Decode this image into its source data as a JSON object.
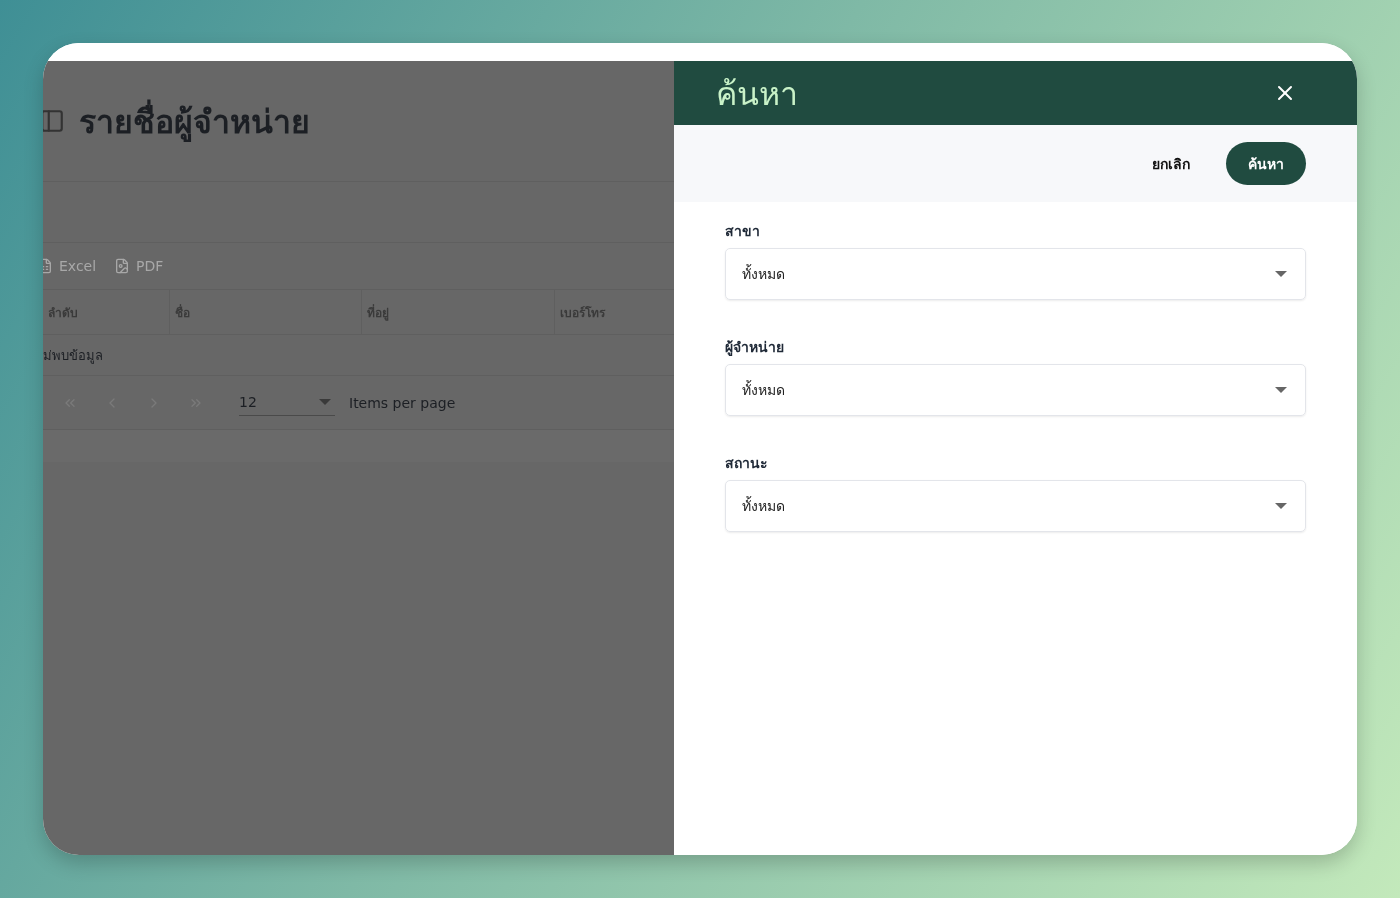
{
  "page": {
    "title": "รายชื่อผู้จำหน่าย",
    "exports": [
      "Excel",
      "PDF"
    ],
    "table": {
      "columns": [
        "ลำดับ",
        "ชื่อ",
        "ที่อยู่",
        "เบอร์โทร"
      ],
      "empty_message": "ม่พบข้อมูล"
    },
    "pagination": {
      "page_size": "12",
      "page_size_label": "Items per page"
    }
  },
  "drawer": {
    "title": "ค้นหา",
    "cancel_button": "ยกเลิก",
    "search_button": "ค้นหา",
    "filters": [
      {
        "label": "สาขา",
        "value": "ทั้งหมด"
      },
      {
        "label": "ผู้จำหน่าย",
        "value": "ทั้งหมด"
      },
      {
        "label": "สถานะ",
        "value": "ทั้งหมด"
      }
    ]
  }
}
